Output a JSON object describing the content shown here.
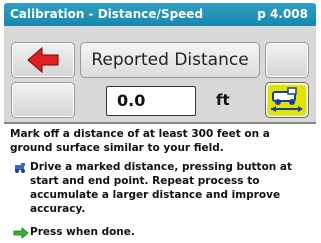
{
  "header": {
    "title": "Calibration - Distance/Speed",
    "page": "p 4.008"
  },
  "controls": {
    "back_icon": "red-left-arrow-icon",
    "vehicle_icon": "vehicle-icon",
    "heading": "Reported Distance",
    "distance_value": "0.0",
    "unit": "ft"
  },
  "instructions": {
    "intro": "Mark off a distance of at least 300 feet on a ground surface similar to your field.",
    "step": "Drive a marked distance, pressing button at start and end point.  Repeat process to accumulate a larger distance and improve accuracy.",
    "done": "Press when done."
  },
  "colors": {
    "titlebar": "#1787ad",
    "arrow": "#e02020",
    "accent_yellow": "#e3e300"
  }
}
